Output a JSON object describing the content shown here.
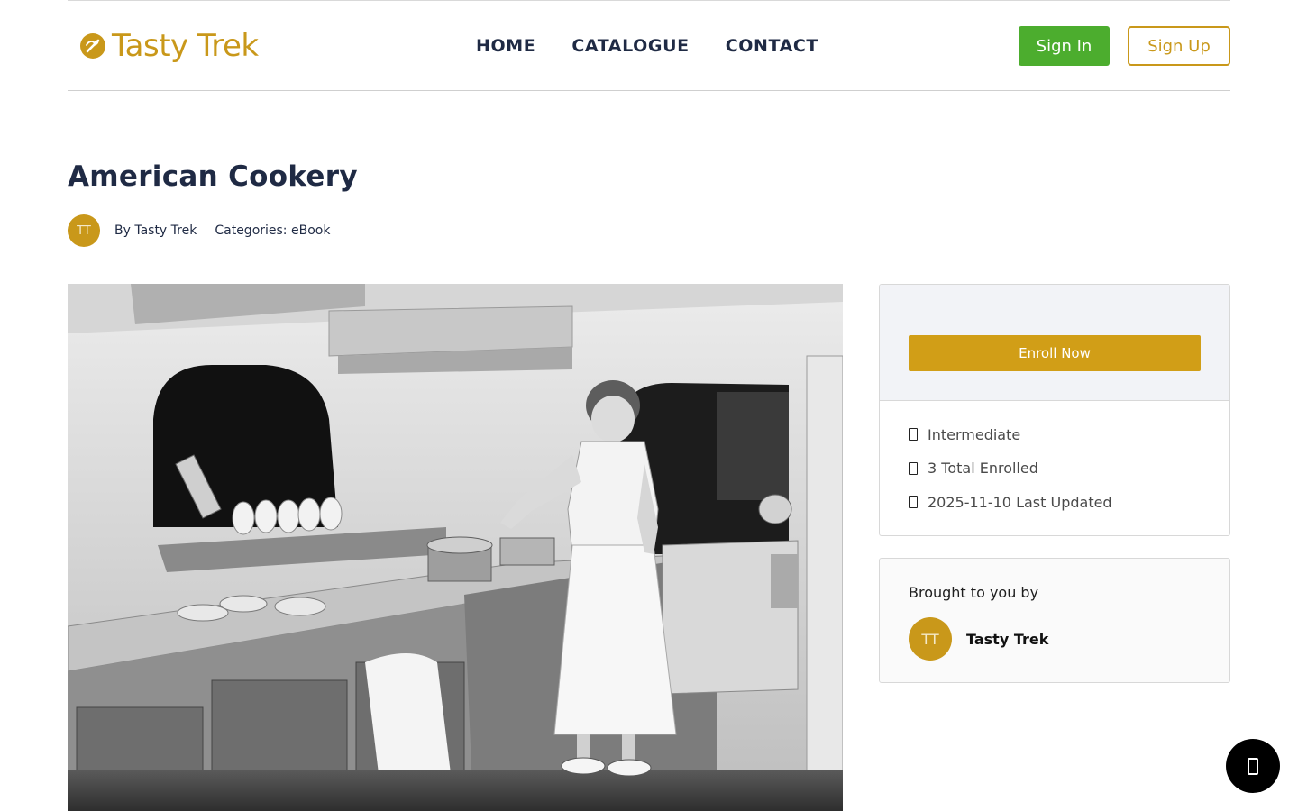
{
  "brand": {
    "name": "Tasty Trek",
    "accent": "#c9981a"
  },
  "nav": {
    "items": [
      "HOME",
      "CATALOGUE",
      "CONTACT"
    ]
  },
  "auth": {
    "sign_in": "Sign In",
    "sign_up": "Sign Up",
    "sign_in_color": "#4cad2e"
  },
  "course": {
    "title": "American Cookery",
    "author_initials": "TT",
    "by_text": "By Tasty Trek",
    "categories_text": "Categories: eBook",
    "image_alt": "vintage-kitchen-photo"
  },
  "enroll_card": {
    "button_label": "Enroll Now",
    "button_color": "#d19e17",
    "items": [
      {
        "icon": "level-icon",
        "text": "Intermediate"
      },
      {
        "icon": "users-icon",
        "text": "3 Total Enrolled"
      },
      {
        "icon": "calendar-icon",
        "text": "2025-11-10 Last Updated"
      }
    ]
  },
  "author_card": {
    "heading": "Brought to you by",
    "initials": "TT",
    "name": "Tasty Trek"
  },
  "fab": {
    "icon": "chat-icon"
  }
}
